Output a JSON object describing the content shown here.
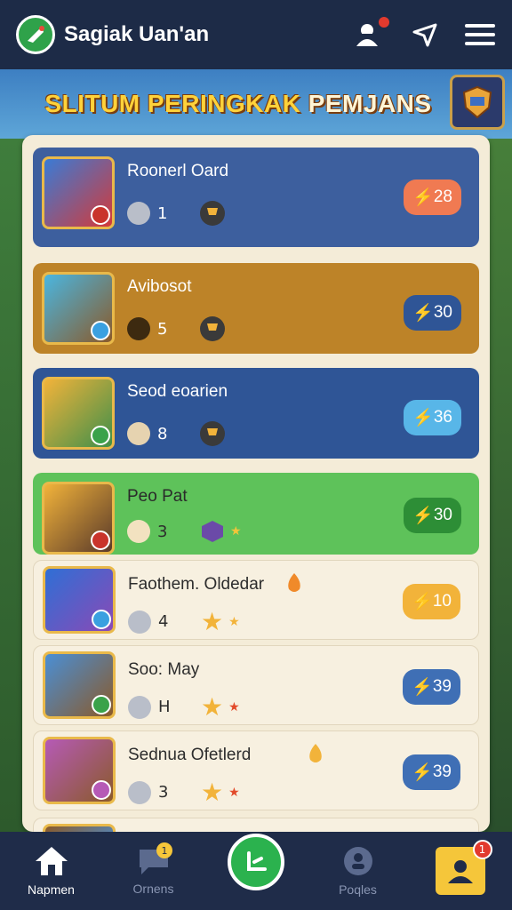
{
  "app": {
    "title": "Sagiak Uan'an"
  },
  "banner": {
    "title_main": "SLITUM PERINGKAK",
    "title_light": "PEMJANS"
  },
  "leaderboard": [
    {
      "name": "Roonerl Oard",
      "rank": "1",
      "score": "28",
      "style": "blue",
      "score_color": "#f07a52"
    },
    {
      "name": "Avibosot",
      "rank": "5",
      "score": "30",
      "style": "gold",
      "score_color": "#2f5596"
    },
    {
      "name": "Seod eoarien",
      "rank": "8",
      "score": "36",
      "style": "navy",
      "score_color": "#58b6e8"
    },
    {
      "name": "Peo Pat",
      "rank": "3",
      "score": "30",
      "style": "green",
      "score_color": "#2d8e36"
    },
    {
      "name": "Faothem. Oldedar",
      "rank": "4",
      "score": "10",
      "style": "cream",
      "score_color": "#f2b33a"
    },
    {
      "name": "Soo: May",
      "rank": "H",
      "score": "39",
      "style": "cream",
      "score_color": "#3f6fb5"
    },
    {
      "name": "Sednua Ofetlerd",
      "rank": "3",
      "score": "39",
      "style": "cream",
      "score_color": "#3f6fb5"
    }
  ],
  "bottom_nav": {
    "home_label": "Napmen",
    "chat_label": "Ornens",
    "chat_badge": "1",
    "people_label": "Poqles",
    "profile_badge": "1"
  },
  "colors": {
    "topbar": "#1d2b47",
    "panel": "#f4ecd8",
    "accent_green": "#2bb24e",
    "badge_red": "#e23a2e"
  }
}
